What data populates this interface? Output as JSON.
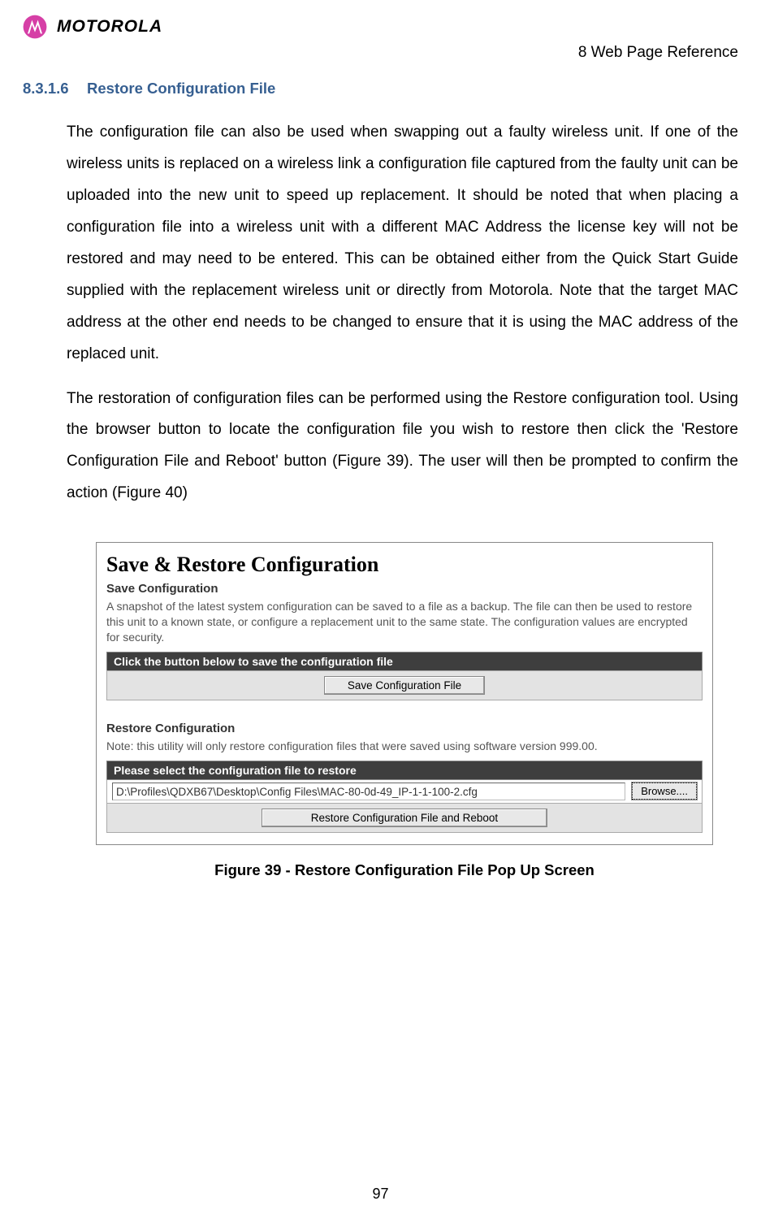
{
  "header": {
    "brand": "MOTOROLA",
    "crumb": "8 Web Page Reference"
  },
  "section": {
    "number": "8.3.1.6",
    "title": "Restore Configuration File"
  },
  "paragraphs": {
    "p1": "The configuration file can also be used when swapping out a faulty wireless unit. If one of the wireless units is replaced on a wireless link a configuration file captured from the faulty unit can be uploaded into the new unit to speed up replacement. It should be noted that when placing a configuration file into a wireless unit with a different MAC Address the license key will not be restored and may need to be entered. This can be obtained either from the Quick Start Guide supplied with the replacement wireless unit or directly from Motorola. Note that the target MAC address at the other end needs to be changed to ensure that it is using the MAC address of the replaced unit.",
    "p2": "The restoration of configuration files can be performed using the Restore configuration tool. Using the browser button to locate the configuration file you wish to restore then click the 'Restore Configuration File and Reboot' button (Figure 39). The user will then be prompted to confirm the action (Figure 40)"
  },
  "screenshot": {
    "title": "Save & Restore Configuration",
    "save_sub": "Save Configuration",
    "save_desc": "A snapshot of the latest system configuration can be saved to a file as a backup. The file can then be used to restore this unit to a known state, or configure a replacement unit to the same state. The configuration values are encrypted for security.",
    "save_bar": "Click the button below to save the configuration file",
    "save_button": "Save Configuration File",
    "restore_sub": "Restore Configuration",
    "restore_note": "Note: this utility will only restore configuration files that were saved using software version 999.00.",
    "restore_bar": "Please select the configuration file to restore",
    "file_path": "D:\\Profiles\\QDXB67\\Desktop\\Config Files\\MAC-80-0d-49_IP-1-1-100-2.cfg",
    "browse": "Browse....",
    "restore_button": "Restore Configuration File and Reboot"
  },
  "figure_caption": "Figure 39 - Restore Configuration File Pop Up Screen",
  "page_number": "97"
}
